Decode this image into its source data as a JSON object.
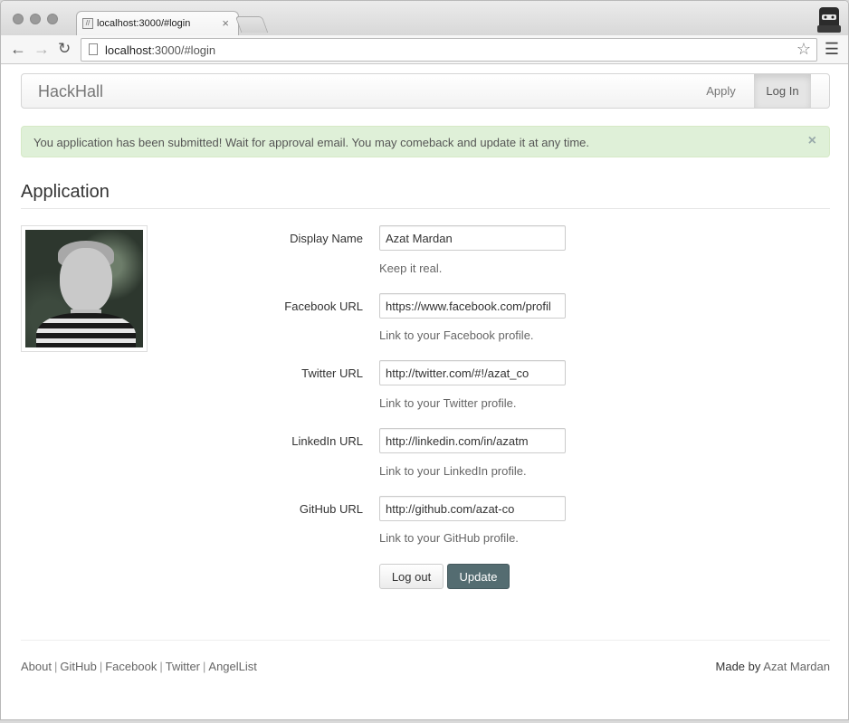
{
  "browser": {
    "tab_title": "localhost:3000/#login",
    "url_host": "localhost",
    "url_rest": ":3000/#login",
    "close_glyph": "×"
  },
  "navbar": {
    "brand": "HackHall",
    "items": [
      {
        "label": "Apply",
        "active": false
      },
      {
        "label": "Log In",
        "active": true
      }
    ]
  },
  "alert": {
    "message": "You application has been submitted! Wait for approval email. You may comeback and update it at any time.",
    "close_glyph": "×",
    "color": "#dff0d8"
  },
  "page": {
    "heading": "Application"
  },
  "form": {
    "fields": [
      {
        "label": "Display Name",
        "value": "Azat Mardan",
        "help": "Keep it real."
      },
      {
        "label": "Facebook URL",
        "value": "https://www.facebook.com/profil",
        "help": "Link to your Facebook profile."
      },
      {
        "label": "Twitter URL",
        "value": "http://twitter.com/#!/azat_co",
        "help": "Link to your Twitter profile."
      },
      {
        "label": "LinkedIn URL",
        "value": "http://linkedin.com/in/azatm",
        "help": "Link to your LinkedIn profile."
      },
      {
        "label": "GitHub URL",
        "value": "http://github.com/azat-co",
        "help": "Link to your GitHub profile."
      }
    ],
    "logout_label": "Log out",
    "update_label": "Update",
    "update_color": "#546c71"
  },
  "footer": {
    "links": [
      "About",
      "GitHub",
      "Facebook",
      "Twitter",
      "AngelList"
    ],
    "separator": "|",
    "made_by_prefix": "Made by",
    "made_by_name": "Azat Mardan"
  }
}
